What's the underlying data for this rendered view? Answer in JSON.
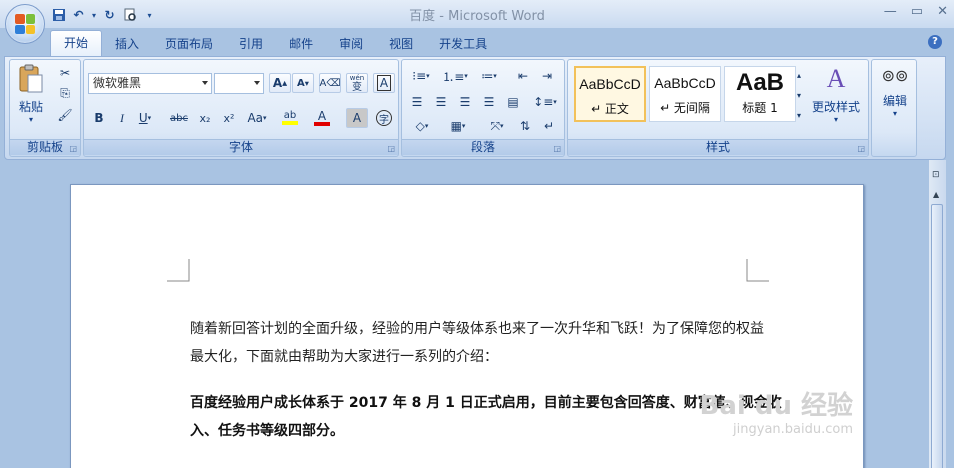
{
  "window": {
    "title": "百度 - Microsoft Word"
  },
  "tabs": [
    "开始",
    "插入",
    "页面布局",
    "引用",
    "邮件",
    "审阅",
    "视图",
    "开发工具"
  ],
  "clipboard": {
    "paste_label": "粘贴",
    "group_label": "剪贴板"
  },
  "font": {
    "name": "微软雅黑",
    "size": "",
    "group_label": "字体",
    "grow": "A",
    "shrink": "A",
    "bold": "B",
    "italic": "I",
    "underline": "U",
    "strike": "abc",
    "sub": "x₂",
    "sup": "x²",
    "case": "Aa",
    "highlight": "ab",
    "color": "A",
    "shade": "A",
    "phonetic": "wén",
    "phonetic_char": "变",
    "border_char": "A",
    "enclose_char": "字"
  },
  "paragraph": {
    "group_label": "段落"
  },
  "styles": {
    "group_label": "样式",
    "items": [
      {
        "sample": "AaBbCcD",
        "name": "↵ 正文"
      },
      {
        "sample": "AaBbCcD",
        "name": "↵ 无间隔"
      },
      {
        "sample": "AaB",
        "name": "标题 1"
      }
    ],
    "change_label": "更改样式"
  },
  "editing": {
    "label": "编辑"
  },
  "document": {
    "para1_line1": "随着新回答计划的全面升级，经验的用户等级体系也来了一次升华和飞跃！为了保障您的权益",
    "para1_line2": "最大化，下面就由帮助为大家进行一系列的介绍：",
    "para2_line1": "百度经验用户成长体系于 2017 年 8 月 1 日正式启用，目前主要包含回答度、财富值、现金收",
    "para2_line2": "入、任务书等级四部分。"
  },
  "watermark": {
    "brand": "Bai du 经验",
    "url": "jingyan.baidu.com"
  }
}
